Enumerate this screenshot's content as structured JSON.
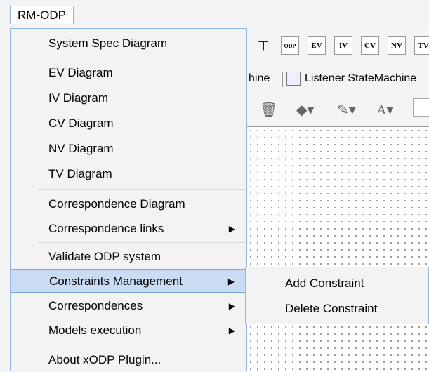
{
  "menubar": {
    "menu_title": "RM-ODP"
  },
  "toolbar": {
    "icons": [
      {
        "name": "pin-icon",
        "label": "⊤"
      },
      {
        "name": "odp-icon",
        "label": "ODP"
      },
      {
        "name": "ev-icon",
        "label": "EV"
      },
      {
        "name": "iv-icon",
        "label": "IV"
      },
      {
        "name": "cv-icon",
        "label": "CV"
      },
      {
        "name": "nv-icon",
        "label": "NV"
      },
      {
        "name": "tv-icon",
        "label": "TV"
      }
    ]
  },
  "tabs": {
    "partial_label": "hine",
    "listener_label": "Listener StateMachine"
  },
  "menu": {
    "items": [
      {
        "label": "System Spec Diagram"
      },
      {
        "label": "EV Diagram"
      },
      {
        "label": "IV Diagram"
      },
      {
        "label": "CV Diagram"
      },
      {
        "label": "NV Diagram"
      },
      {
        "label": "TV Diagram"
      },
      {
        "label": "Correspondence Diagram"
      },
      {
        "label": "Correspondence links",
        "submenu": true
      },
      {
        "label": "Validate ODP system"
      },
      {
        "label": "Constraints Management",
        "submenu": true,
        "highlighted": true
      },
      {
        "label": "Correspondences",
        "submenu": true
      },
      {
        "label": "Models execution",
        "submenu": true
      },
      {
        "label": "About xODP Plugin..."
      }
    ]
  },
  "submenu": {
    "items": [
      {
        "label": "Add Constraint"
      },
      {
        "label": "Delete Constraint"
      }
    ]
  },
  "colors": {
    "menu_border": "#8fb7e4",
    "highlight": "#c9dcf3"
  }
}
